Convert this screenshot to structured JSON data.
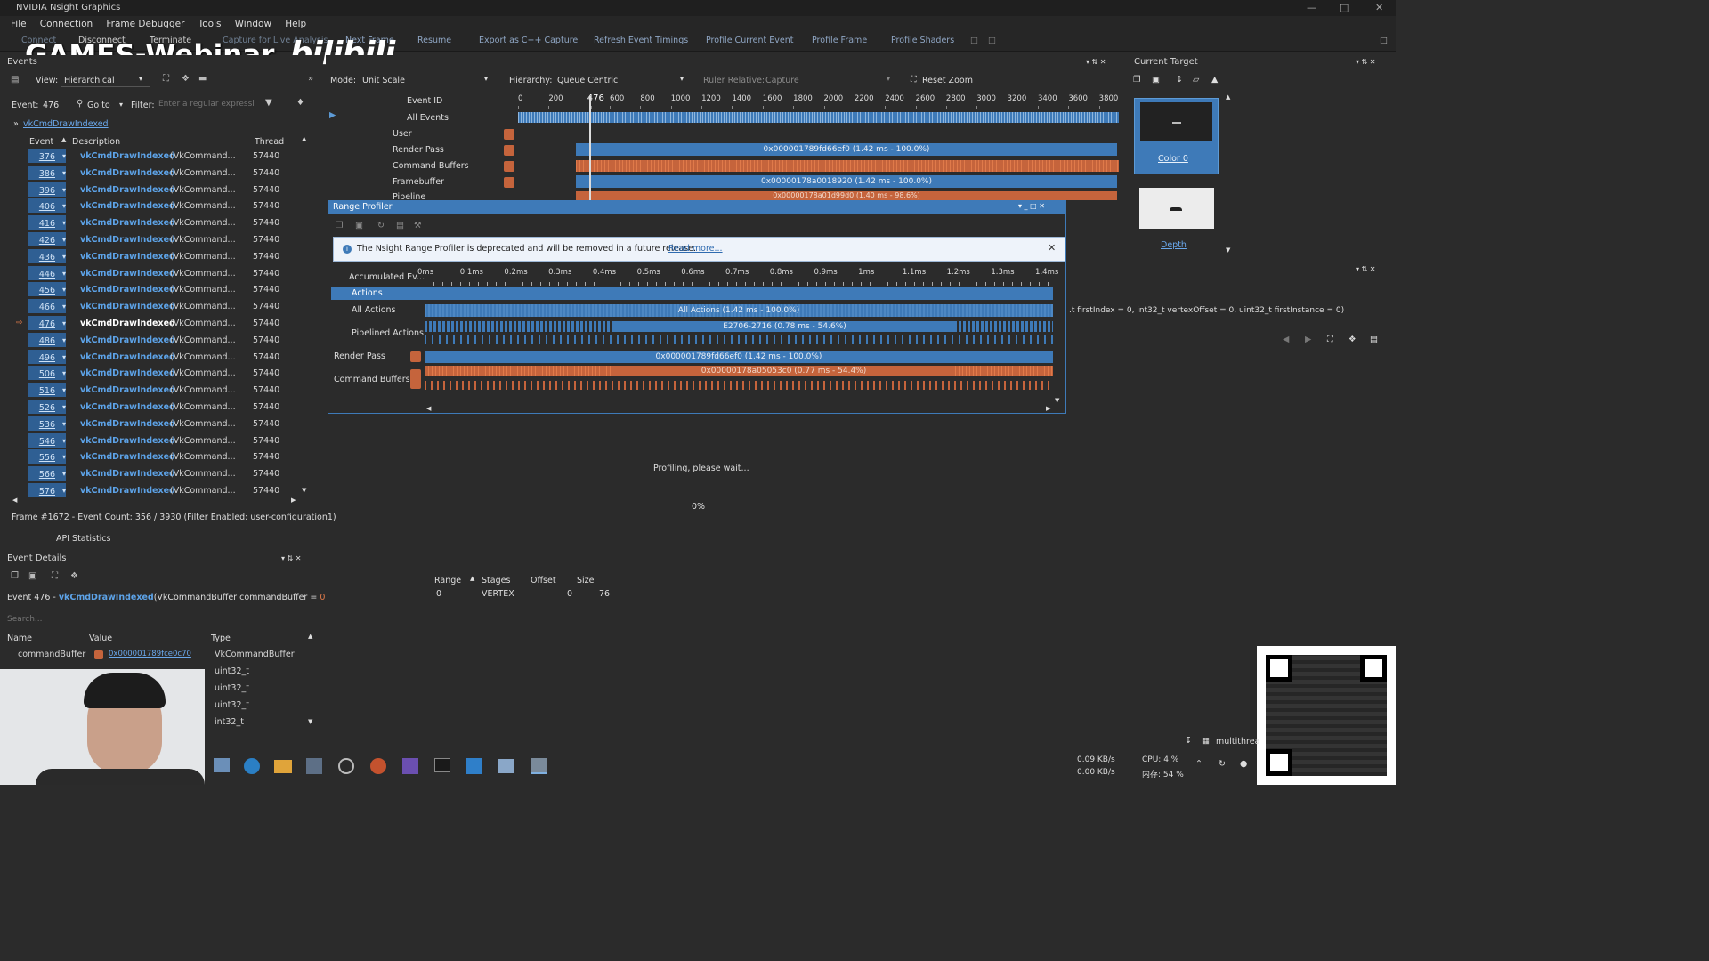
{
  "window": {
    "title": "NVIDIA Nsight Graphics"
  },
  "menu": [
    "File",
    "Connection",
    "Frame Debugger",
    "Tools",
    "Window",
    "Help"
  ],
  "toolbar": [
    "Connect",
    "Disconnect",
    "Terminate",
    "Capture for Live Analysis",
    "Next Frame",
    "Resume",
    "Export as C++ Capture",
    "Refresh Event Timings",
    "Profile Current Event",
    "Profile Frame",
    "Profile Shaders"
  ],
  "watermark": {
    "text": "GAMES-Webinar",
    "logo": "bilibili"
  },
  "events": {
    "panel_title": "Events",
    "view_label": "View:",
    "view_value": "Hierarchical",
    "event_label": "Event:",
    "event_value": "476",
    "goto": "Go to",
    "filter_label": "Filter:",
    "filter_placeholder": "Enter a regular expressi",
    "breadcrumb": "vkCmdDrawIndexed",
    "columns": [
      "Event",
      "Description",
      "Thread"
    ],
    "rows": [
      {
        "id": "376",
        "fn": "vkCmdDrawIndexed",
        "arg": "(VkCommand...",
        "thread": "57440"
      },
      {
        "id": "386",
        "fn": "vkCmdDrawIndexed",
        "arg": "(VkCommand...",
        "thread": "57440"
      },
      {
        "id": "396",
        "fn": "vkCmdDrawIndexed",
        "arg": "(VkCommand...",
        "thread": "57440"
      },
      {
        "id": "406",
        "fn": "vkCmdDrawIndexed",
        "arg": "(VkCommand...",
        "thread": "57440"
      },
      {
        "id": "416",
        "fn": "vkCmdDrawIndexed",
        "arg": "(VkCommand...",
        "thread": "57440"
      },
      {
        "id": "426",
        "fn": "vkCmdDrawIndexed",
        "arg": "(VkCommand...",
        "thread": "57440"
      },
      {
        "id": "436",
        "fn": "vkCmdDrawIndexed",
        "arg": "(VkCommand...",
        "thread": "57440"
      },
      {
        "id": "446",
        "fn": "vkCmdDrawIndexed",
        "arg": "(VkCommand...",
        "thread": "57440"
      },
      {
        "id": "456",
        "fn": "vkCmdDrawIndexed",
        "arg": "(VkCommand...",
        "thread": "57440"
      },
      {
        "id": "466",
        "fn": "vkCmdDrawIndexed",
        "arg": "(VkCommand...",
        "thread": "57440"
      },
      {
        "id": "476",
        "fn": "vkCmdDrawIndexed",
        "arg": "(VkCommand...",
        "thread": "57440",
        "current": true
      },
      {
        "id": "486",
        "fn": "vkCmdDrawIndexed",
        "arg": "(VkCommand...",
        "thread": "57440"
      },
      {
        "id": "496",
        "fn": "vkCmdDrawIndexed",
        "arg": "(VkCommand...",
        "thread": "57440"
      },
      {
        "id": "506",
        "fn": "vkCmdDrawIndexed",
        "arg": "(VkCommand...",
        "thread": "57440"
      },
      {
        "id": "516",
        "fn": "vkCmdDrawIndexed",
        "arg": "(VkCommand...",
        "thread": "57440"
      },
      {
        "id": "526",
        "fn": "vkCmdDrawIndexed",
        "arg": "(VkCommand...",
        "thread": "57440"
      },
      {
        "id": "536",
        "fn": "vkCmdDrawIndexed",
        "arg": "(VkCommand...",
        "thread": "57440"
      },
      {
        "id": "546",
        "fn": "vkCmdDrawIndexed",
        "arg": "(VkCommand...",
        "thread": "57440"
      },
      {
        "id": "556",
        "fn": "vkCmdDrawIndexed",
        "arg": "(VkCommand...",
        "thread": "57440"
      },
      {
        "id": "566",
        "fn": "vkCmdDrawIndexed",
        "arg": "(VkCommand...",
        "thread": "57440"
      },
      {
        "id": "576",
        "fn": "vkCmdDrawIndexed",
        "arg": "(VkCommand...",
        "thread": "57440"
      }
    ],
    "status": "Frame #1672 - Event Count: 356 / 3930 (Filter Enabled: user-configuration1)",
    "api_stats": "API Statistics"
  },
  "event_details": {
    "title": "Event Details",
    "header_prefix": "Event 476 - ",
    "header_fn": "vkCmdDrawIndexed",
    "header_arg": "(VkCommandBuffer commandBuffer = ",
    "header_val": "0",
    "search_placeholder": "Search...",
    "columns": [
      "Name",
      "Value",
      "Type"
    ],
    "rows": [
      {
        "name": "commandBuffer",
        "value": "0x000001789fce0c70",
        "type": "VkCommandBuffer"
      },
      {
        "name": "",
        "value": "",
        "type": "uint32_t"
      },
      {
        "name": "",
        "value": "",
        "type": "uint32_t"
      },
      {
        "name": "",
        "value": "",
        "type": "uint32_t"
      },
      {
        "name": "",
        "value": "",
        "type": "int32_t"
      }
    ]
  },
  "timeline": {
    "mode_label": "Mode:",
    "mode_value": "Unit Scale",
    "hierarchy_label": "Hierarchy:",
    "hierarchy_value": "Queue Centric",
    "ruler_label": "Ruler Relative:",
    "ruler_value": "Capture",
    "reset_zoom": "Reset Zoom",
    "ticks": [
      "0",
      "200",
      "476",
      "600",
      "800",
      "1000",
      "1200",
      "1400",
      "1600",
      "1800",
      "2000",
      "2200",
      "2400",
      "2600",
      "2800",
      "3000",
      "3200",
      "3400",
      "3600",
      "3800"
    ],
    "rows": [
      "Event ID",
      "All Events",
      "User",
      "Render Pass",
      "Command Buffers",
      "Framebuffer",
      "Pipeline"
    ],
    "bar_render_pass": "0x000001789fd66ef0 (1.42 ms - 100.0%)",
    "bar_framebuffer": "0x00000178a0018920 (1.42 ms - 100.0%)",
    "bar_pipeline": "0x00000178a01d99d0 (1.40 ms - 98.6%)"
  },
  "range_profiler": {
    "title": "Range Profiler",
    "banner": "The Nsight Range Profiler is deprecated and will be removed in a future release.",
    "banner_link": "Read more...",
    "ticks": [
      "0ms",
      "0.1ms",
      "0.2ms",
      "0.3ms",
      "0.4ms",
      "0.5ms",
      "0.6ms",
      "0.7ms",
      "0.8ms",
      "0.9ms",
      "1ms",
      "1.1ms",
      "1.2ms",
      "1.3ms",
      "1.4ms"
    ],
    "rows": [
      "Accumulated Ev...",
      "Actions",
      "All Actions",
      "Pipelined Actions",
      "Render Pass",
      "Command Buffers"
    ],
    "bar_all_actions": "All Actions (1.42 ms - 100.0%)",
    "bar_pipelined": "E2706-2716 (0.78 ms - 54.6%)",
    "bar_render_pass": "0x000001789fd66ef0 (1.42 ms - 100.0%)",
    "bar_command_buffers": "0x00000178a05053c0 (0.77 ms - 54.4%)",
    "profiling": "Profiling, please wait...",
    "percent": "0%",
    "table_columns": [
      "Range",
      "Stages",
      "Offset",
      "Size"
    ],
    "table_row": [
      "0",
      "VERTEX",
      "0",
      "76"
    ]
  },
  "current_target": {
    "title": "Current Target",
    "color_label": "Color 0",
    "depth_label": "Depth"
  },
  "api_args": ".t firstIndex = 0, int32_t vertexOffset = 0, uint32_t firstInstance = 0)",
  "taskbar": {
    "net_up": "0.09 KB/s",
    "net_down": "0.00 KB/s",
    "cpu": "CPU: 4 %",
    "mem": "内存: 54 %",
    "tray_app": "multithrea"
  },
  "colors": {
    "accent_blue": "#3e7ab8",
    "accent_orange": "#c5643c",
    "bg": "#2b2b2b"
  }
}
